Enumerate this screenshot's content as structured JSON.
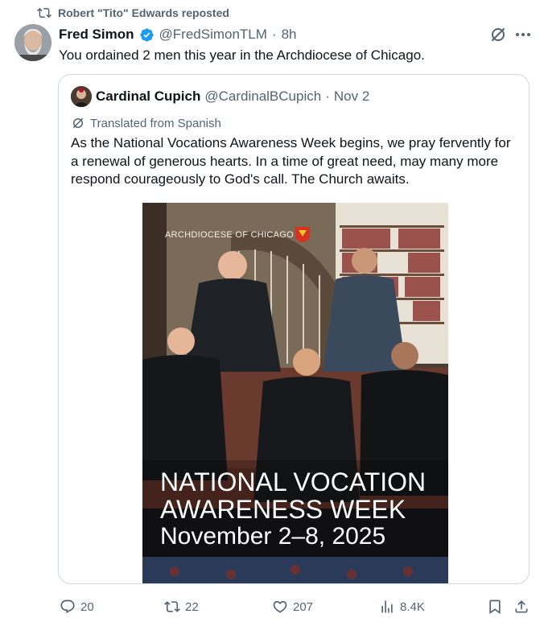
{
  "repost": {
    "label": "Robert \"Tito\" Edwards reposted"
  },
  "tweet": {
    "name": "Fred Simon",
    "handle": "@FredSimonTLM",
    "separator": "·",
    "time": "8h",
    "text": "You ordained 2 men this year in the Archdiocese of Chicago."
  },
  "quote": {
    "name": "Cardinal Cupich",
    "handle": "@CardinalBCupich",
    "separator": "·",
    "date": "Nov 2",
    "translated": "Translated from Spanish",
    "text": "As the National Vocations Awareness Week begins, we pray fervently for a renewal of generous hearts. In a time of great need, may many more respond courageously to God's call. The Church awaits."
  },
  "image": {
    "org_label": "ARCHDIOCESE OF CHICAGO",
    "title_line1": "NATIONAL VOCATION",
    "title_line2": "AWARENESS WEEK",
    "dates": "November 2–8, 2025"
  },
  "actions": {
    "replies": "20",
    "reposts": "22",
    "likes": "207",
    "views": "8.4K"
  },
  "colors": {
    "verified": "#1d9bf0",
    "text": "#0f1419",
    "muted": "#536471",
    "border": "#cfd9de"
  }
}
